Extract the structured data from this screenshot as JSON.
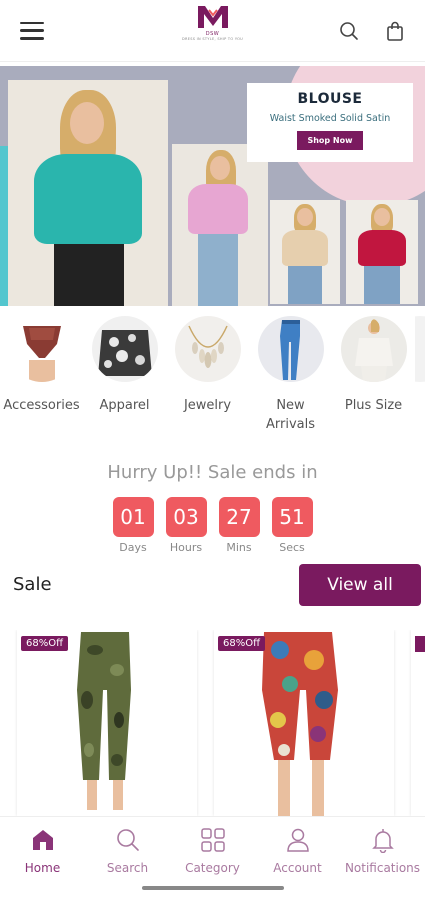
{
  "header": {
    "menu_icon": "hamburger-icon",
    "logo_brand": "DSW",
    "logo_tagline": "DRESS IN STYLE, SHIP TO YOU",
    "search_icon": "search-icon",
    "cart_icon": "shopping-bag-icon"
  },
  "banner": {
    "title": "BLOUSE",
    "subtitle": "Waist Smoked Solid Satin",
    "button_label": "Shop Now"
  },
  "categories": [
    {
      "label": "Accessories"
    },
    {
      "label": "Apparel"
    },
    {
      "label": "Jewelry"
    },
    {
      "label": "New Arrivals"
    },
    {
      "label": "Plus Size"
    }
  ],
  "countdown": {
    "title": "Hurry Up!! Sale ends in",
    "units": [
      {
        "value": "01",
        "label": "Days"
      },
      {
        "value": "03",
        "label": "Hours"
      },
      {
        "value": "27",
        "label": "Mins"
      },
      {
        "value": "51",
        "label": "Secs"
      }
    ]
  },
  "sale": {
    "title": "Sale",
    "view_all_label": "View all",
    "products": [
      {
        "badge": "68%Off"
      },
      {
        "badge": "68%Off"
      }
    ]
  },
  "bottom_nav": [
    {
      "label": "Home",
      "icon": "home-icon",
      "active": true
    },
    {
      "label": "Search",
      "icon": "search-icon",
      "active": false
    },
    {
      "label": "Category",
      "icon": "category-grid-icon",
      "active": false
    },
    {
      "label": "Account",
      "icon": "account-icon",
      "active": false
    },
    {
      "label": "Notifications",
      "icon": "bell-icon",
      "active": false
    }
  ],
  "colors": {
    "brand": "#7a1a5f",
    "countdown": "#ef5a60",
    "nav_inactive": "#a97aa0"
  }
}
